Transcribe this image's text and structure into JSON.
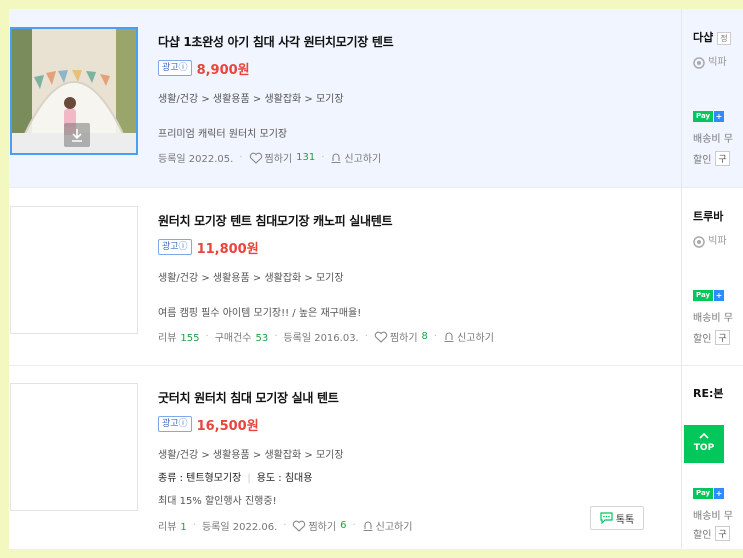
{
  "items": [
    {
      "title": "다샵 1초완성 아기 침대 사각 원터치모기장 텐트",
      "ad": "광고ⓘ",
      "price": "8,900원",
      "category": "생활/건강 > 생활용품 > 생활잡화 > 모기장",
      "desc": "프리미엄 캐릭터 원터치 모기장",
      "registered": "등록일 2022.05.",
      "wish_label": "찜하기",
      "wish_count": "131",
      "report": "신고하기",
      "mall": "다샵",
      "mall_tag": "정",
      "grade": "빅파",
      "ship": "배송비 무",
      "disc": "할인",
      "disc_box": "구"
    },
    {
      "title": "원터치 모기장 텐트 침대모기장 캐노피 실내텐트",
      "ad": "광고ⓘ",
      "price": "11,800원",
      "category": "생활/건강 > 생활용품 > 생활잡화 > 모기장",
      "desc": "여름 캠핑 필수 아이템 모기장!! / 높은 재구매율!",
      "review_label": "리뷰",
      "review_count": "155",
      "purchase_label": "구매건수",
      "purchase_count": "53",
      "registered": "등록일 2016.03.",
      "wish_label": "찜하기",
      "wish_count": "8",
      "report": "신고하기",
      "mall": "트루바",
      "grade": "빅파",
      "ship": "배송비 무",
      "disc": "할인",
      "disc_box": "구"
    },
    {
      "title": "굿터치 원터치 침대 모기장 실내 텐트",
      "ad": "광고ⓘ",
      "price": "16,500원",
      "category": "생활/건강 > 생활용품 > 생활잡화 > 모기장",
      "spec1": "종류 : 텐트형모기장",
      "spec2": "용도 : 침대용",
      "desc": "최대 15% 할인행사 진행중!",
      "review_label": "리뷰",
      "review_count": "1",
      "registered": "등록일 2022.06.",
      "wish_label": "찜하기",
      "wish_count": "6",
      "report": "신고하기",
      "talk": "톡톡",
      "mall": "RE:본",
      "ship": "배송비 무",
      "disc": "할인",
      "disc_box": "구"
    }
  ],
  "npay": {
    "label": "Pay",
    "plus": "+"
  },
  "top_button": "TOP",
  "colors": {
    "price": "#e8453c",
    "highlight_bg": "#f0f5ff",
    "count_green": "#21a04a",
    "npay_green": "#03c75a",
    "page_bg": "#f3f7c0"
  }
}
